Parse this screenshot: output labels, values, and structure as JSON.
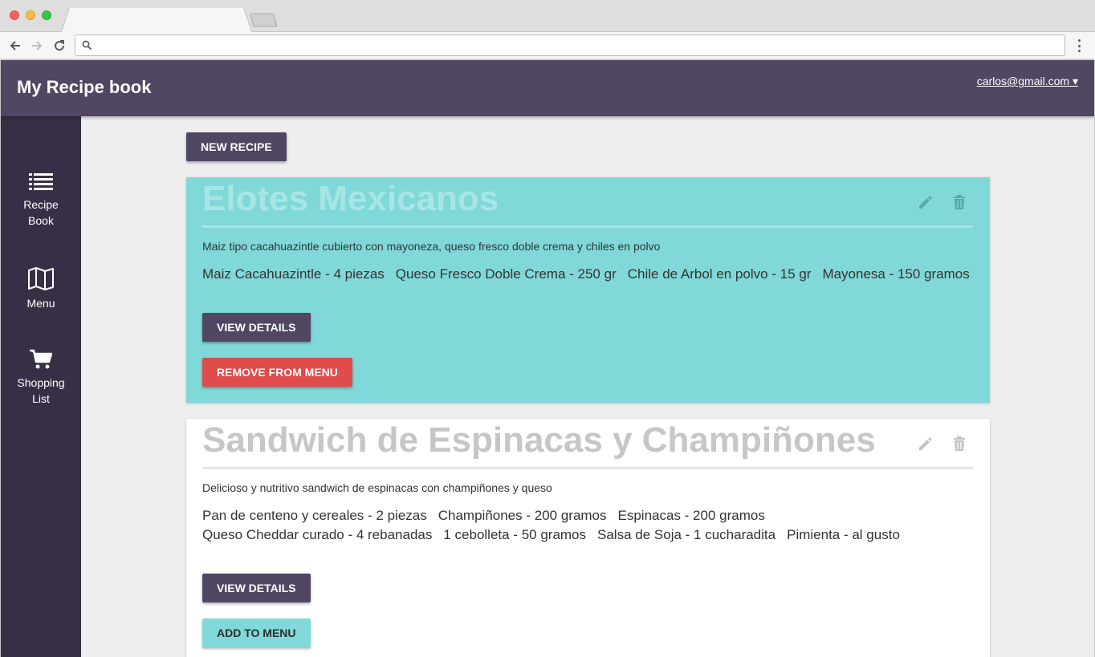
{
  "browser": {
    "url": "",
    "tab_title": ""
  },
  "app": {
    "title": "My Recipe book",
    "user": "carlos@gmail.com ▾"
  },
  "sidebar": {
    "items": [
      {
        "label": "Recipe Book",
        "icon": "list-icon"
      },
      {
        "label": "Menu",
        "icon": "map-icon"
      },
      {
        "label": "Shopping List",
        "icon": "cart-icon"
      }
    ]
  },
  "actions": {
    "new_recipe": "NEW RECIPE"
  },
  "recipes": [
    {
      "title": "Elotes Mexicanos",
      "description": "Maiz tipo cacahuazintle cubierto con mayoneza, queso fresco doble crema y chiles en polvo",
      "ingredients": [
        "Maiz Cacahuazintle - 4 piezas",
        "Queso Fresco Doble Crema - 250 gr",
        "Chile de Arbol en polvo - 15 gr",
        "Mayonesa - 150 gramos"
      ],
      "details_label": "VIEW DETAILS",
      "menu_label": "REMOVE FROM MENU",
      "in_menu": true
    },
    {
      "title": "Sandwich de Espinacas y Champiñones",
      "description": "Delicioso y nutritivo sandwich de espinacas con champiñones y queso",
      "ingredients": [
        "Pan de centeno y cereales - 2 piezas",
        "Champiñones - 200 gramos",
        "Espinacas - 200 gramos",
        "Queso Cheddar curado - 4 rebanadas",
        "1 cebolleta - 50 gramos",
        "Salsa de Soja - 1 cucharadita",
        "Pimienta - al gusto"
      ],
      "details_label": "VIEW DETAILS",
      "menu_label": "ADD TO MENU",
      "in_menu": false
    }
  ],
  "colors": {
    "header": "#514762",
    "sidebar": "#372f45",
    "teal_card": "#80d8d8",
    "remove_button": "#e04b4b",
    "add_button": "#80d8d8"
  }
}
